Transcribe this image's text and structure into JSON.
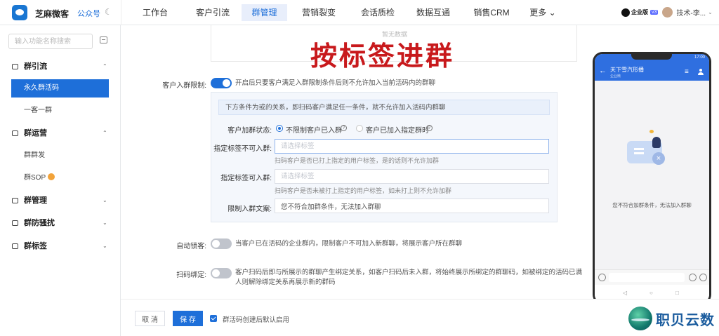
{
  "topbar": {
    "brand": "芝麻微客",
    "gzh_label": "公众号",
    "theme_icon": "moon-icon",
    "nav": [
      "工作台",
      "客户引流",
      "群管理",
      "营销裂变",
      "会话质检",
      "数据互通",
      "销售CRM",
      "更多 ⌄"
    ],
    "active_nav": "群管理",
    "enterprise_label": "企业版",
    "version_label": "v3",
    "username": "技术-李...",
    "accent_color": "#1e6fd9"
  },
  "sidebar": {
    "search_placeholder": "输入功能名称搜索",
    "groups": [
      {
        "label": "群引流",
        "chevron": "⌃"
      },
      {
        "label": "群运营",
        "chevron": "⌃"
      },
      {
        "label": "群管理",
        "chevron": "⌄"
      },
      {
        "label": "群防骚扰",
        "chevron": "⌄"
      },
      {
        "label": "群标签",
        "chevron": "⌄"
      }
    ],
    "items": [
      "永久群活码",
      "一客一群",
      "群群发",
      "群SOP"
    ],
    "active_item": "永久群活码"
  },
  "main": {
    "empty_text": "暂无数据",
    "overlay_title": "按标签进群",
    "entry_limit": {
      "label": "客户入群限制:",
      "enabled": true,
      "desc": "开启后只要客户满足入群限制条件后则不允许加入当前活码内的群聊"
    },
    "panel": {
      "notice": "下方条件为或的关系，即扫码客户满足任一条件，就不允许加入活码内群聊",
      "join_status_label": "客户加群状态:",
      "radio_options": [
        "不限制客户已入群",
        "客户已加入指定群时"
      ],
      "selected_radio": 0,
      "tag_no_label": "指定标签不可入群:",
      "tag_no_placeholder": "请选择标签",
      "tag_no_hint": "扫码客户是否已打上指定的用户标签，是的话则不允许加群",
      "tag_yes_label": "指定标签可入群:",
      "tag_yes_placeholder": "请选择标签",
      "tag_yes_hint": "扫码客户是否未被打上指定的用户标签，如未打上则不允许加群",
      "copy_label": "限制入群文案:",
      "copy_value": "您不符合加群条件，无法加入群聊"
    },
    "auto_lock": {
      "label": "自动锁客:",
      "enabled": false,
      "desc": "当客户已在活码的企业群内，限制客户不可加入新群聊，将展示客户所在群聊"
    },
    "scan_bind": {
      "label": "扫码绑定:",
      "enabled": false,
      "desc1": "客户扫码后即与所展示的群聊产生绑定关系，如客户扫码后未入群，将始终展示所绑定的群聊码，如被绑定的活码已满",
      "desc2": "人则解除绑定关系再展示新的群码"
    }
  },
  "phone": {
    "status_time": "17:00",
    "title": "天下雪汽形播",
    "subtitle": "企业微",
    "message": "您不符合加群条件，无法加入群聊",
    "nav_icons": [
      "◁",
      "○",
      "□"
    ]
  },
  "footer": {
    "cancel": "取 消",
    "save": "保 存",
    "default_enable_label": "群活码创建后默认启用",
    "default_enable_checked": true
  },
  "watermark": {
    "text": "职贝云数"
  }
}
